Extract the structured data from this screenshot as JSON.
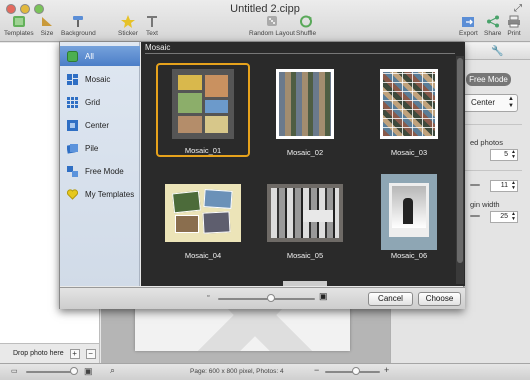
{
  "window": {
    "title": "Untitled 2.cipp"
  },
  "toolbar": {
    "templates": "Templates",
    "size": "Size",
    "background": "Background",
    "sticker": "Sticker",
    "text": "Text",
    "random_layout": "Random Layout",
    "shuffle": "Shuffle",
    "export": "Export",
    "share": "Share",
    "print": "Print"
  },
  "left_panel": {
    "drop_label": "Drop photo here",
    "add": "+",
    "remove": "−"
  },
  "inspector": {
    "mode": "Free Mode",
    "align_value": "Center",
    "row1_label": "ed photos",
    "row1_value": "5",
    "row2_value": "11",
    "row3_label": "gin width",
    "row3_value": "25"
  },
  "status": {
    "text": "Page: 600 x 800 pixel, Photos: 4"
  },
  "sheet": {
    "categories": [
      {
        "label": "All",
        "icon": "all-icon",
        "color": "#4caf50"
      },
      {
        "label": "Mosaic",
        "icon": "mosaic-icon",
        "color": "#2f6fc4"
      },
      {
        "label": "Grid",
        "icon": "grid-icon",
        "color": "#2f6fc4"
      },
      {
        "label": "Center",
        "icon": "center-icon",
        "color": "#2f6fc4"
      },
      {
        "label": "Pile",
        "icon": "pile-icon",
        "color": "#2f6fc4"
      },
      {
        "label": "Free Mode",
        "icon": "free-mode-icon",
        "color": "#2f6fc4"
      },
      {
        "label": "My Templates",
        "icon": "heart-icon",
        "color": "#e6c81c"
      }
    ],
    "gallery_title": "Mosaic",
    "templates": [
      "Mosaic_01",
      "Mosaic_02",
      "Mosaic_03",
      "Mosaic_04",
      "Mosaic_05",
      "Mosaic_06"
    ],
    "selected_template": "Mosaic_01",
    "cancel": "Cancel",
    "choose": "Choose"
  },
  "colors": {
    "selection": "#e6a21c",
    "accent": "#4c7ec7"
  }
}
